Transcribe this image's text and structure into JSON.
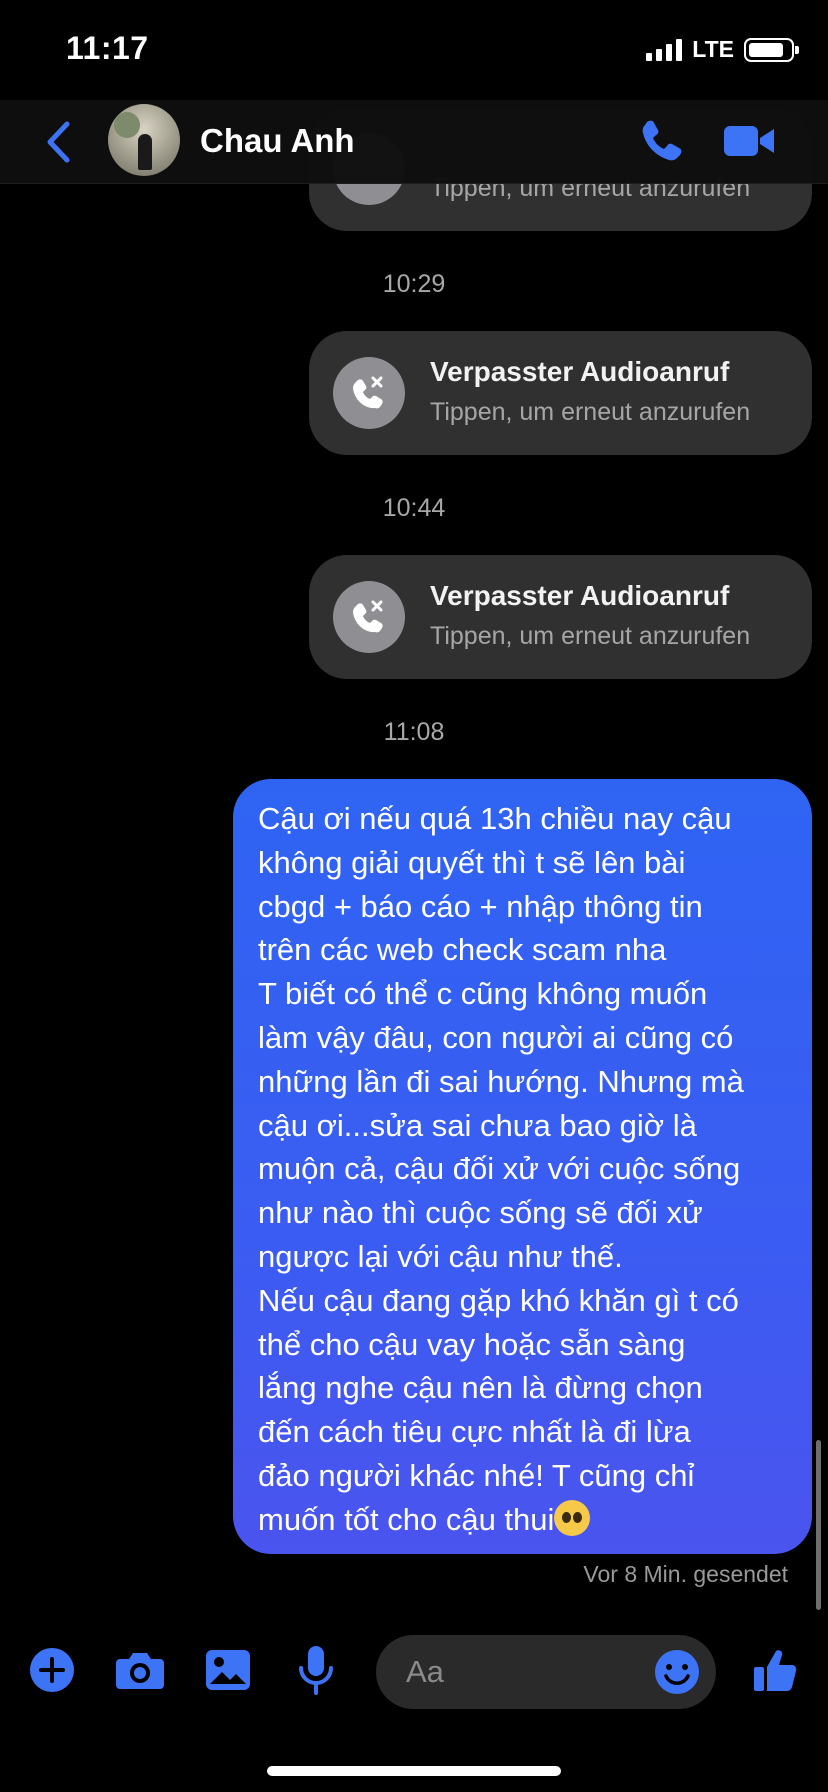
{
  "status_bar": {
    "time": "11:17",
    "network": "LTE",
    "battery_level": 0.85
  },
  "header": {
    "contact_name": "Chau Anh",
    "accent_color": "#3d74f5"
  },
  "chat": {
    "partial_call": {
      "subtitle": "Tippen, um erneut anzurufen"
    },
    "timestamps": [
      "10:29",
      "10:44",
      "11:08"
    ],
    "missed_calls": [
      {
        "title": "Verpasster Audioanruf",
        "subtitle": "Tippen, um erneut anzurufen"
      },
      {
        "title": "Verpasster Audioanruf",
        "subtitle": "Tippen, um erneut anzurufen"
      }
    ],
    "outgoing_message": {
      "text": "Cậu ơi nếu quá 13h chiều nay cậu\nkhông giải quyết thì t sẽ lên bài\ncbgd + báo cáo + nhập thông tin\ntrên các web check scam nha\nT biết có thể c cũng không muốn\nlàm vậy đâu, con người ai cũng có\nnhững lần đi sai hướng. Nhưng mà\ncậu ơi...sửa sai chưa bao giờ là\nmuộn cả, cậu đối xử với cuộc sống\nnhư nào thì cuộc sống sẽ đối xử\nngược lại với cậu như thế.\nNếu cậu đang gặp khó khăn gì t có\nthể cho cậu vay hoặc sẵn sàng\nlắng nghe cậu nên là đừng chọn\nđến cách tiêu cực nhất là đi lừa\nđảo người khác nhé! T cũng chỉ\nmuốn tốt cho cậu thui",
      "emoji": "pleading-face"
    },
    "delivery_status": "Vor 8 Min. gesendet"
  },
  "composer": {
    "placeholder": "Aa",
    "icons": [
      "plus-icon",
      "camera-icon",
      "photo-icon",
      "microphone-icon",
      "emoji-icon",
      "thumbs-up-icon"
    ]
  }
}
